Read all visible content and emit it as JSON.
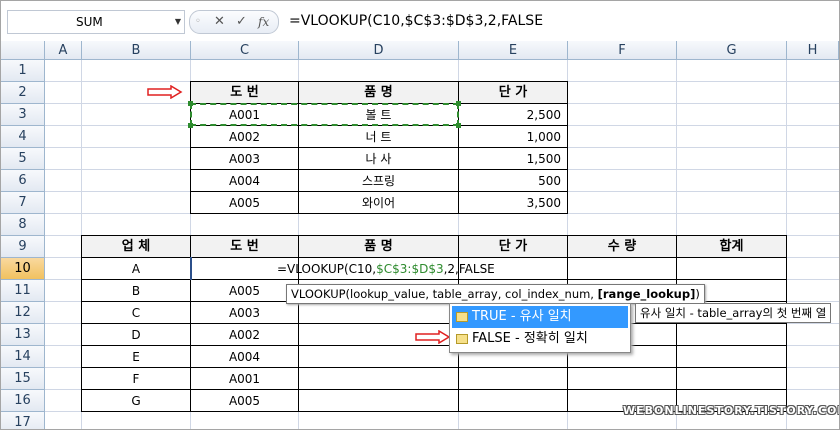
{
  "formula_bar": {
    "name_box": "SUM",
    "cancel_glyph": "✕",
    "enter_glyph": "✓",
    "function_glyph": "fx",
    "formula": "=VLOOKUP(C10,$C$3:$D$3,2,FALSE"
  },
  "columns": [
    "A",
    "B",
    "C",
    "D",
    "E",
    "F",
    "G",
    "H"
  ],
  "rows": [
    "1",
    "2",
    "3",
    "4",
    "5",
    "6",
    "7",
    "8",
    "9",
    "10",
    "11",
    "12",
    "13",
    "14",
    "15",
    "16",
    "17"
  ],
  "active_row": "10",
  "price_table": {
    "headers": [
      "도  번",
      "품  명",
      "단  가"
    ],
    "rows": [
      [
        "A001",
        "볼  트",
        "2,500"
      ],
      [
        "A002",
        "너  트",
        "1,000"
      ],
      [
        "A003",
        "나  사",
        "1,500"
      ],
      [
        "A004",
        "스프링",
        "500"
      ],
      [
        "A005",
        "와이어",
        "3,500"
      ]
    ]
  },
  "order_table": {
    "headers": [
      "업  체",
      "도  번",
      "품  명",
      "단  가",
      "수  량",
      "합계"
    ],
    "rows": [
      [
        "A",
        ""
      ],
      [
        "B",
        "A005"
      ],
      [
        "C",
        "A003"
      ],
      [
        "D",
        "A002"
      ],
      [
        "E",
        "A004"
      ],
      [
        "F",
        "A001"
      ],
      [
        "G",
        "A005"
      ]
    ]
  },
  "editing_cell": {
    "prefix": "=VLOOKUP(C10,",
    "range": "$C$3:$D$3",
    "suffix": ",2,FALSE"
  },
  "signature_tooltip": {
    "text": "VLOOKUP(lookup_value, table_array, col_index_num, ",
    "bold_arg": "[range_lookup]",
    "close": ")"
  },
  "autocomplete": {
    "items": [
      {
        "label": "TRUE - 유사 일치",
        "icon": "argument-icon",
        "highlighted": true
      },
      {
        "label": "FALSE - 정확히 일치",
        "icon": "argument-icon",
        "highlighted": false
      }
    ],
    "hint": "유사 일치 - table_array의 첫 번째 열"
  },
  "watermark": "WEBONLINESTORY.TISTORY.COM",
  "colors": {
    "reference_green": "#2e8b2e",
    "highlight_blue": "#3399ff",
    "arrow_red": "#e02020"
  }
}
